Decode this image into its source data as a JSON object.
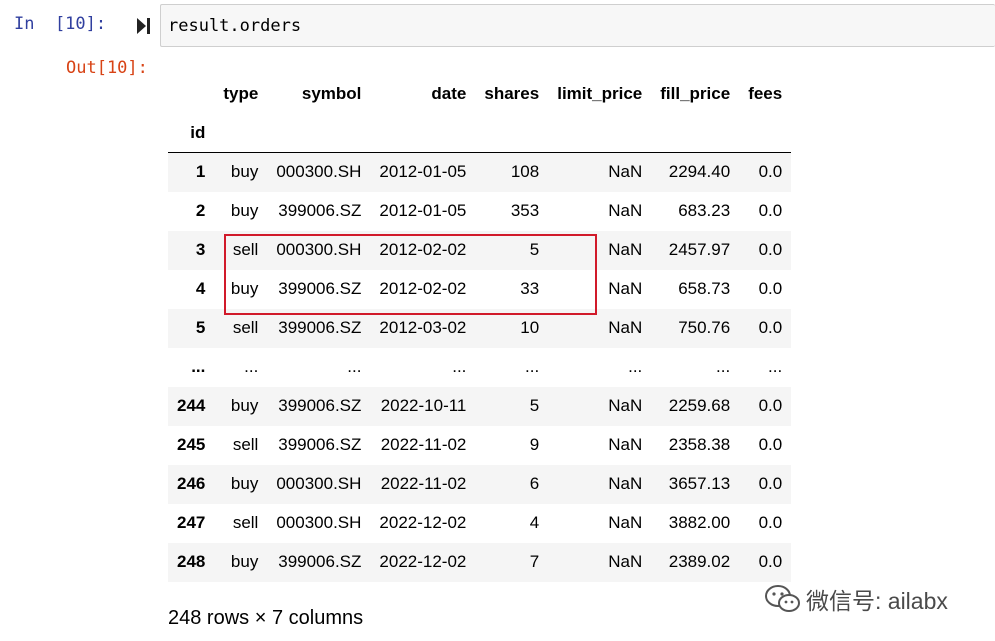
{
  "input": {
    "prompt": "In  [10]:",
    "code": "result.orders"
  },
  "output": {
    "prompt": "Out[10]:"
  },
  "table": {
    "columns": [
      "type",
      "symbol",
      "date",
      "shares",
      "limit_price",
      "fill_price",
      "fees"
    ],
    "index_name": "id",
    "rows": [
      {
        "id": "1",
        "cells": [
          "buy",
          "000300.SH",
          "2012-01-05",
          "108",
          "NaN",
          "2294.40",
          "0.0"
        ]
      },
      {
        "id": "2",
        "cells": [
          "buy",
          "399006.SZ",
          "2012-01-05",
          "353",
          "NaN",
          "683.23",
          "0.0"
        ]
      },
      {
        "id": "3",
        "cells": [
          "sell",
          "000300.SH",
          "2012-02-02",
          "5",
          "NaN",
          "2457.97",
          "0.0"
        ]
      },
      {
        "id": "4",
        "cells": [
          "buy",
          "399006.SZ",
          "2012-02-02",
          "33",
          "NaN",
          "658.73",
          "0.0"
        ]
      },
      {
        "id": "5",
        "cells": [
          "sell",
          "399006.SZ",
          "2012-03-02",
          "10",
          "NaN",
          "750.76",
          "0.0"
        ]
      },
      {
        "id": "...",
        "cells": [
          "...",
          "...",
          "...",
          "...",
          "...",
          "...",
          "..."
        ]
      },
      {
        "id": "244",
        "cells": [
          "buy",
          "399006.SZ",
          "2022-10-11",
          "5",
          "NaN",
          "2259.68",
          "0.0"
        ]
      },
      {
        "id": "245",
        "cells": [
          "sell",
          "399006.SZ",
          "2022-11-02",
          "9",
          "NaN",
          "2358.38",
          "0.0"
        ]
      },
      {
        "id": "246",
        "cells": [
          "buy",
          "000300.SH",
          "2022-11-02",
          "6",
          "NaN",
          "3657.13",
          "0.0"
        ]
      },
      {
        "id": "247",
        "cells": [
          "sell",
          "000300.SH",
          "2022-12-02",
          "4",
          "NaN",
          "3882.00",
          "0.0"
        ]
      },
      {
        "id": "248",
        "cells": [
          "buy",
          "399006.SZ",
          "2022-12-02",
          "7",
          "NaN",
          "2389.02",
          "0.0"
        ]
      }
    ],
    "summary": "248 rows × 7 columns"
  },
  "watermark": {
    "text": "微信号: ailabx",
    "icon": "wechat-icon"
  },
  "colors": {
    "in_prompt": "#303f9f",
    "out_prompt": "#d84315",
    "highlight": "#d11a2a"
  }
}
